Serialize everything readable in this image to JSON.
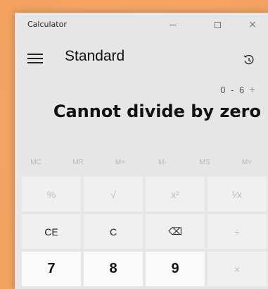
{
  "window": {
    "title": "Calculator",
    "minimize_icon": "minimize-icon",
    "maximize_icon": "maximize-icon",
    "close_icon": "close-icon",
    "close_label": "×"
  },
  "header": {
    "menu_icon": "hamburger-menu-icon",
    "mode": "Standard",
    "history_icon": "history-icon"
  },
  "display": {
    "expression": "0 - 6 ÷",
    "result": "Cannot divide by zero"
  },
  "memory": [
    "MC",
    "MR",
    "M+",
    "M-",
    "MS",
    "M˅"
  ],
  "keypad": [
    [
      {
        "label": "%",
        "state": "disabled"
      },
      {
        "label": "√",
        "state": "disabled"
      },
      {
        "label": "x²",
        "state": "disabled"
      },
      {
        "label": "¹⁄x",
        "state": "disabled"
      }
    ],
    [
      {
        "label": "CE",
        "state": "enabled"
      },
      {
        "label": "C",
        "state": "enabled"
      },
      {
        "label": "⌫",
        "state": "enabled"
      },
      {
        "label": "÷",
        "state": "disabled"
      }
    ],
    [
      {
        "label": "7",
        "state": "enabled"
      },
      {
        "label": "8",
        "state": "enabled"
      },
      {
        "label": "9",
        "state": "enabled"
      },
      {
        "label": "×",
        "state": "disabled"
      }
    ]
  ],
  "colors": {
    "accent_glow": "#f4a363",
    "window_bg": "#e6e6e6",
    "key_bg": "#f0f0f0",
    "digit_bg": "#fafafa",
    "disabled_text": "#bdbdbd"
  }
}
